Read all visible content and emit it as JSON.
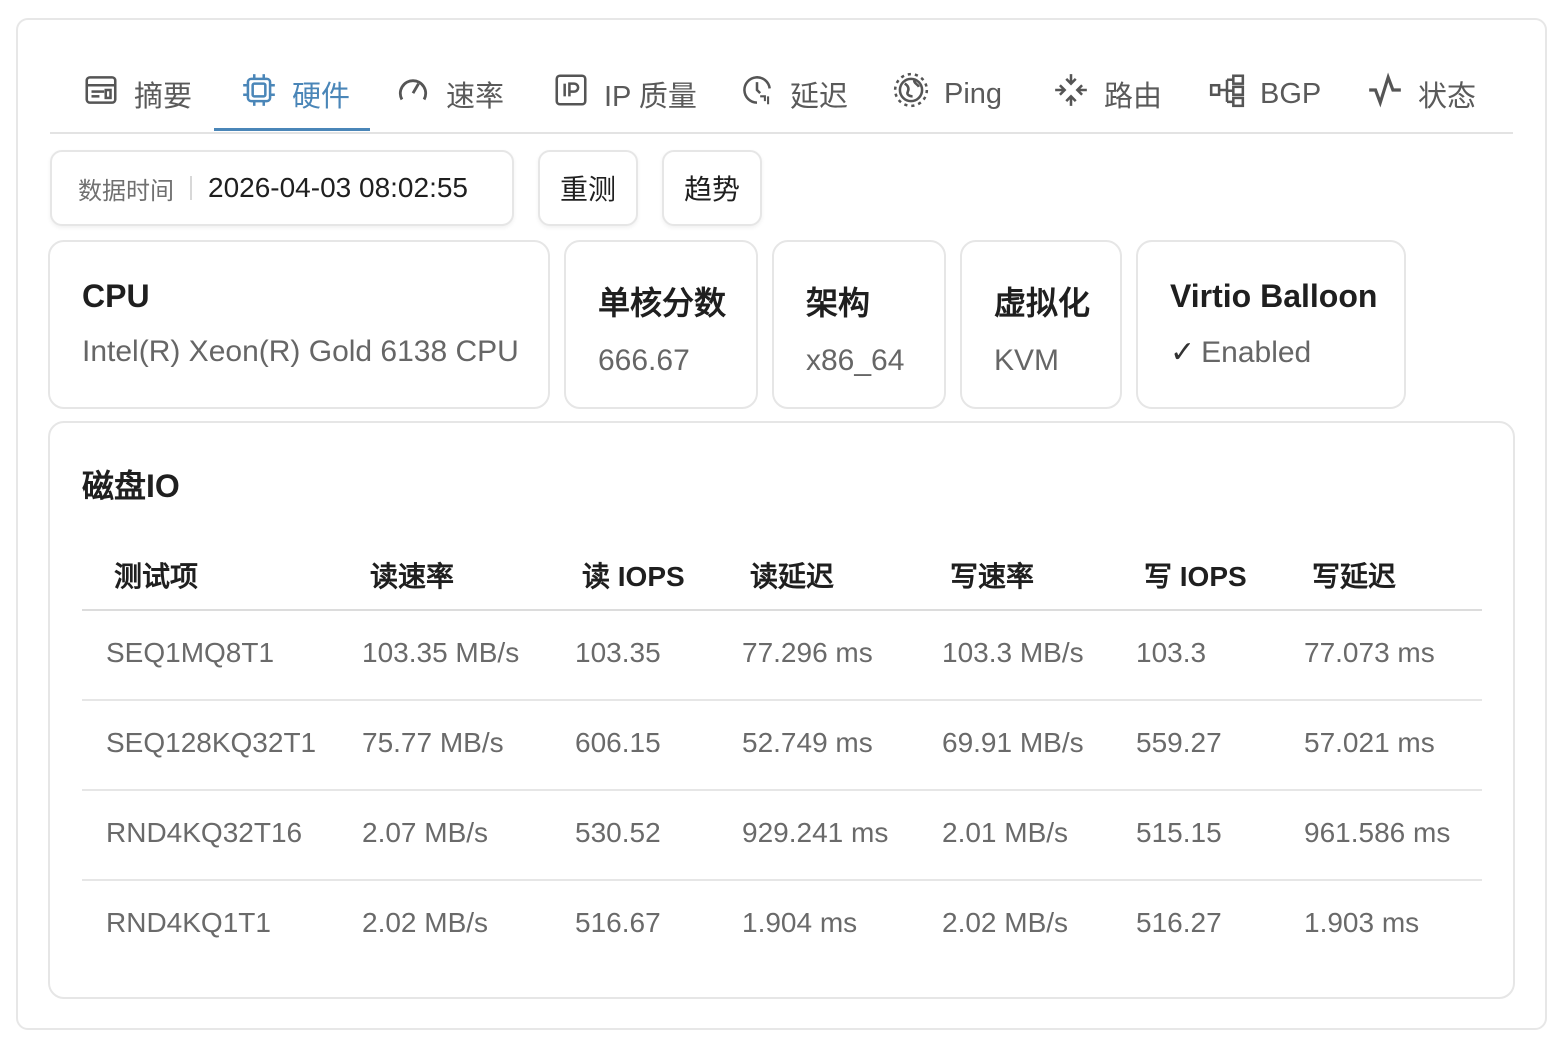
{
  "tabs": [
    {
      "label": "摘要",
      "icon": "summary-icon"
    },
    {
      "label": "硬件",
      "icon": "chip-icon",
      "active": true
    },
    {
      "label": "速率",
      "icon": "speedometer-icon"
    },
    {
      "label": "IP 质量",
      "icon": "ip-icon"
    },
    {
      "label": "延迟",
      "icon": "clock-24-icon"
    },
    {
      "label": "Ping",
      "icon": "globe-icon"
    },
    {
      "label": "路由",
      "icon": "route-arrows-icon"
    },
    {
      "label": "BGP",
      "icon": "network-tree-icon"
    },
    {
      "label": "状态",
      "icon": "activity-icon"
    }
  ],
  "toolbar": {
    "time_label": "数据时间",
    "time_value": "2026-04-03 08:02:55",
    "retest_label": "重测",
    "trend_label": "趋势"
  },
  "cards": {
    "cpu": {
      "title": "CPU",
      "value": "Intel(R) Xeon(R) Gold 6138 CPU"
    },
    "single_core": {
      "title": "单核分数",
      "value": "666.67"
    },
    "arch": {
      "title": "架构",
      "value": "x86_64"
    },
    "virt": {
      "title": "虚拟化",
      "value": "KVM"
    },
    "balloon": {
      "title": "Virtio Balloon",
      "check": "✓",
      "value": "Enabled"
    }
  },
  "disk": {
    "title": "磁盘IO",
    "headers": [
      "测试项",
      "读速率",
      "读 IOPS",
      "读延迟",
      "写速率",
      "写 IOPS",
      "写延迟"
    ],
    "rows": [
      [
        "SEQ1MQ8T1",
        "103.35 MB/s",
        "103.35",
        "77.296 ms",
        "103.3 MB/s",
        "103.3",
        "77.073 ms"
      ],
      [
        "SEQ128KQ32T1",
        "75.77 MB/s",
        "606.15",
        "52.749 ms",
        "69.91 MB/s",
        "559.27",
        "57.021 ms"
      ],
      [
        "RND4KQ32T16",
        "2.07 MB/s",
        "530.52",
        "929.241 ms",
        "2.01 MB/s",
        "515.15",
        "961.586 ms"
      ],
      [
        "RND4KQ1T1",
        "2.02 MB/s",
        "516.67",
        "1.904 ms",
        "2.02 MB/s",
        "516.27",
        "1.903 ms"
      ]
    ]
  },
  "colors": {
    "accent": "#4a86b8",
    "border": "#e6e6e6",
    "muted_text": "#6a6a6a"
  }
}
